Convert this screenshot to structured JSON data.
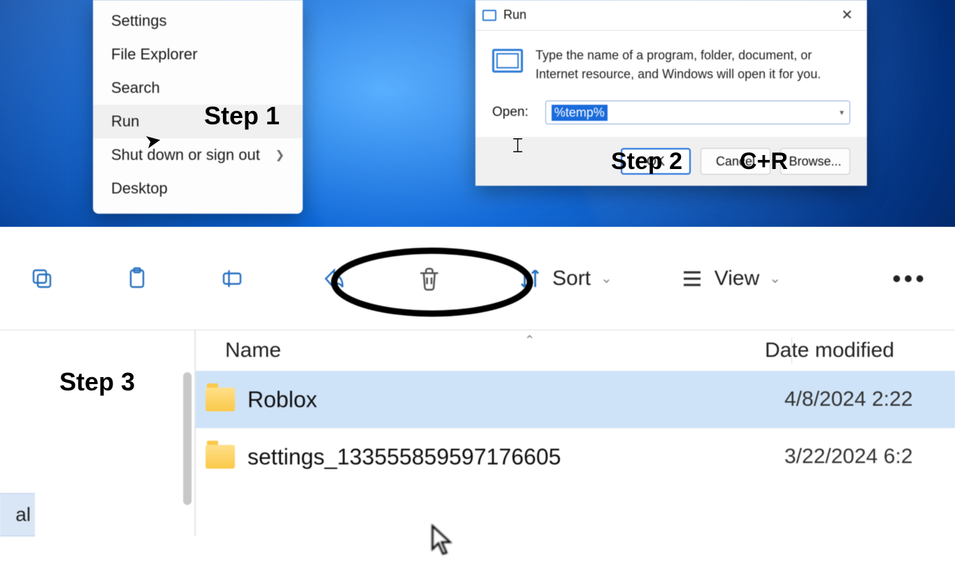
{
  "annotations": {
    "step1": "Step 1",
    "step2": "Step 2",
    "step2_shortcut": "C+R",
    "step3": "Step 3"
  },
  "start_menu": {
    "items": [
      {
        "label": "Settings",
        "has_submenu": false
      },
      {
        "label": "File Explorer",
        "has_submenu": false
      },
      {
        "label": "Search",
        "has_submenu": false
      },
      {
        "label": "Run",
        "has_submenu": false
      },
      {
        "label": "Shut down or sign out",
        "has_submenu": true
      },
      {
        "label": "Desktop",
        "has_submenu": false
      }
    ]
  },
  "run_dialog": {
    "title": "Run",
    "description": "Type the name of a program, folder, document, or Internet resource, and Windows will open it for you.",
    "open_label": "Open:",
    "open_value": "%temp%",
    "buttons": {
      "ok": "OK",
      "cancel": "Cancel",
      "browse": "Browse..."
    }
  },
  "explorer": {
    "toolbar": {
      "sort_label": "Sort",
      "view_label": "View"
    },
    "columns": {
      "name": "Name",
      "date": "Date modified"
    },
    "left_cut_text": "al",
    "rows": [
      {
        "name": "Roblox",
        "date": "4/8/2024 2:22",
        "selected": true
      },
      {
        "name": "settings_133555859597176605",
        "date": "3/22/2024 6:2",
        "selected": false
      }
    ]
  }
}
